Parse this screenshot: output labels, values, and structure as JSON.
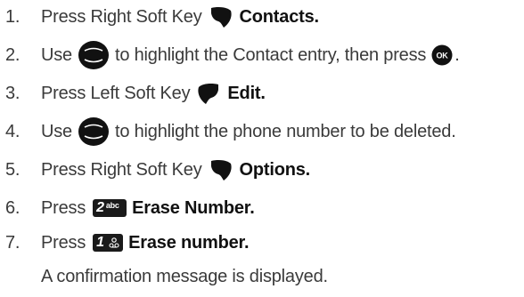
{
  "steps": [
    {
      "num": "1.",
      "text": "Press Right Soft Key",
      "icon": "right-soft-key-icon",
      "bold": "Contacts."
    },
    {
      "num": "2.",
      "pre": "Use",
      "icon": "navigation-key-icon",
      "text": "to highlight the Contact entry, then press",
      "icon2": "ok-key-icon",
      "ok_label": "OK",
      "tail": "."
    },
    {
      "num": "3.",
      "text": "Press Left Soft Key",
      "icon": "left-soft-key-icon",
      "bold": "Edit."
    },
    {
      "num": "4.",
      "pre": "Use",
      "icon": "navigation-key-icon",
      "text": "to highlight the phone number to be deleted."
    },
    {
      "num": "5.",
      "text": "Press Right Soft Key",
      "icon": "right-soft-key-icon",
      "bold": "Options."
    },
    {
      "num": "6.",
      "text": "Press",
      "key": "2",
      "key_sub": "abc",
      "bold": "Erase Number."
    },
    {
      "num": "7.",
      "text": "Press",
      "key": "1",
      "key_sub": "voicemail",
      "bold": "Erase number."
    }
  ],
  "note": "A confirmation message is displayed."
}
